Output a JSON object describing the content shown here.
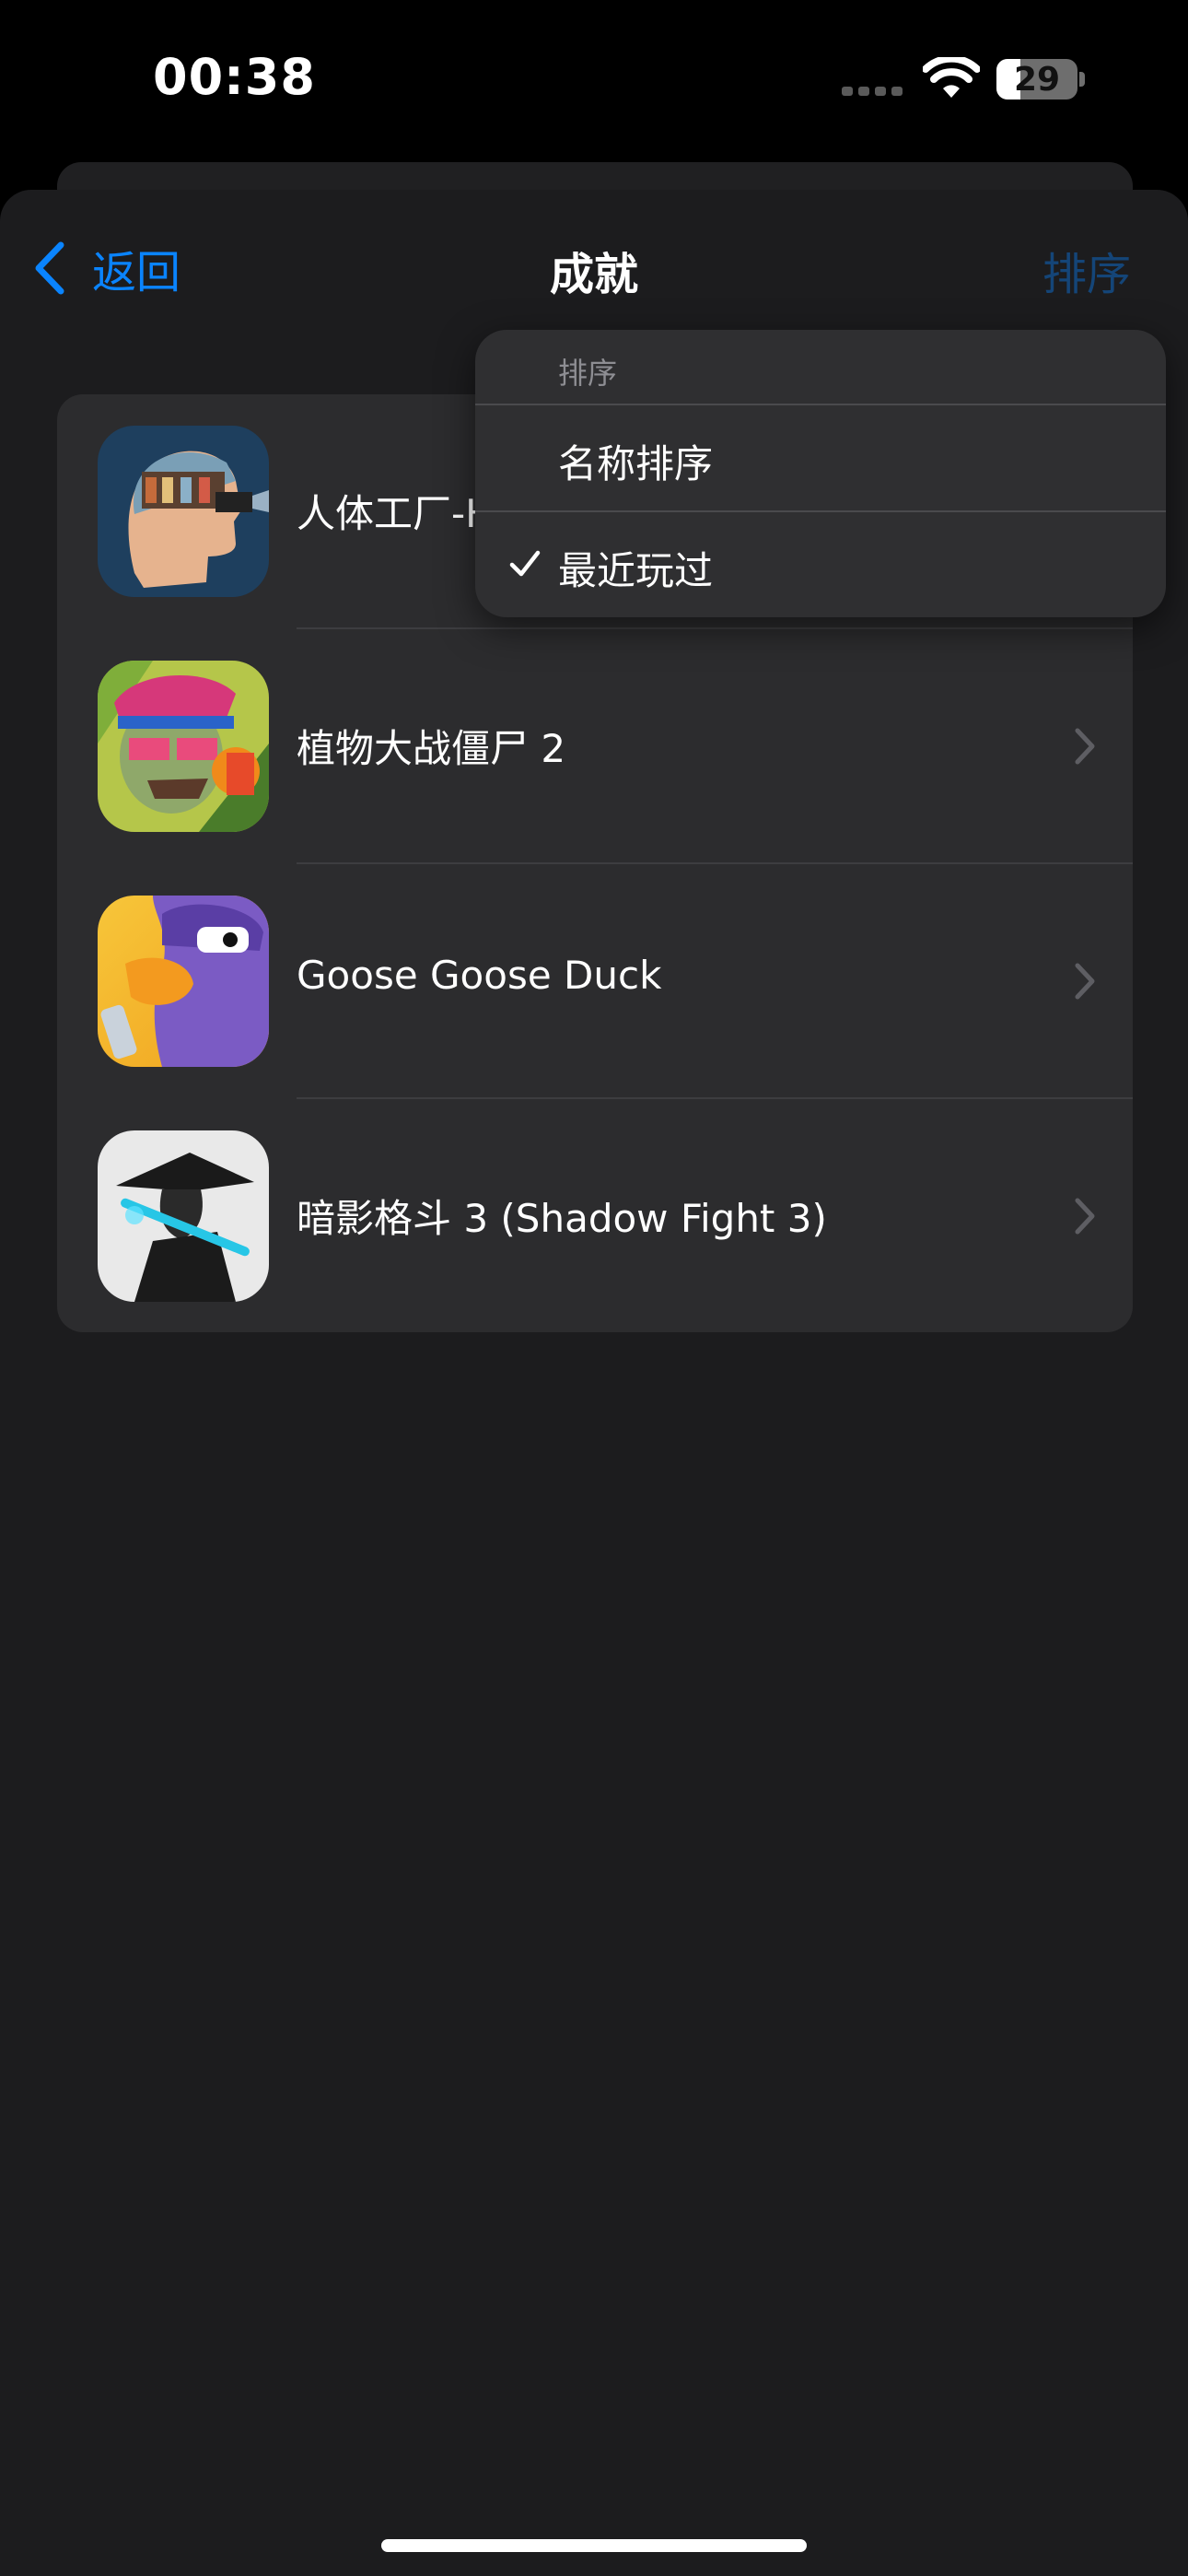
{
  "status_bar": {
    "time": "00:38",
    "battery_level": "29",
    "battery_fraction": 0.29
  },
  "nav": {
    "back_label": "返回",
    "title": "成就",
    "sort_label": "排序"
  },
  "games": [
    {
      "name": "人体工厂-Human Body"
    },
    {
      "name": "植物大战僵尸 2"
    },
    {
      "name": "Goose Goose Duck"
    },
    {
      "name": "暗影格斗 3 (Shadow Fight 3)"
    }
  ],
  "sort_menu": {
    "header": "排序",
    "options": [
      {
        "label": "名称排序",
        "selected": false
      },
      {
        "label": "最近玩过",
        "selected": true
      }
    ]
  },
  "colors": {
    "accent": "#0a84ff",
    "background": "#1c1c1e",
    "card": "#2c2c2e",
    "menu": "#2f2f31"
  }
}
